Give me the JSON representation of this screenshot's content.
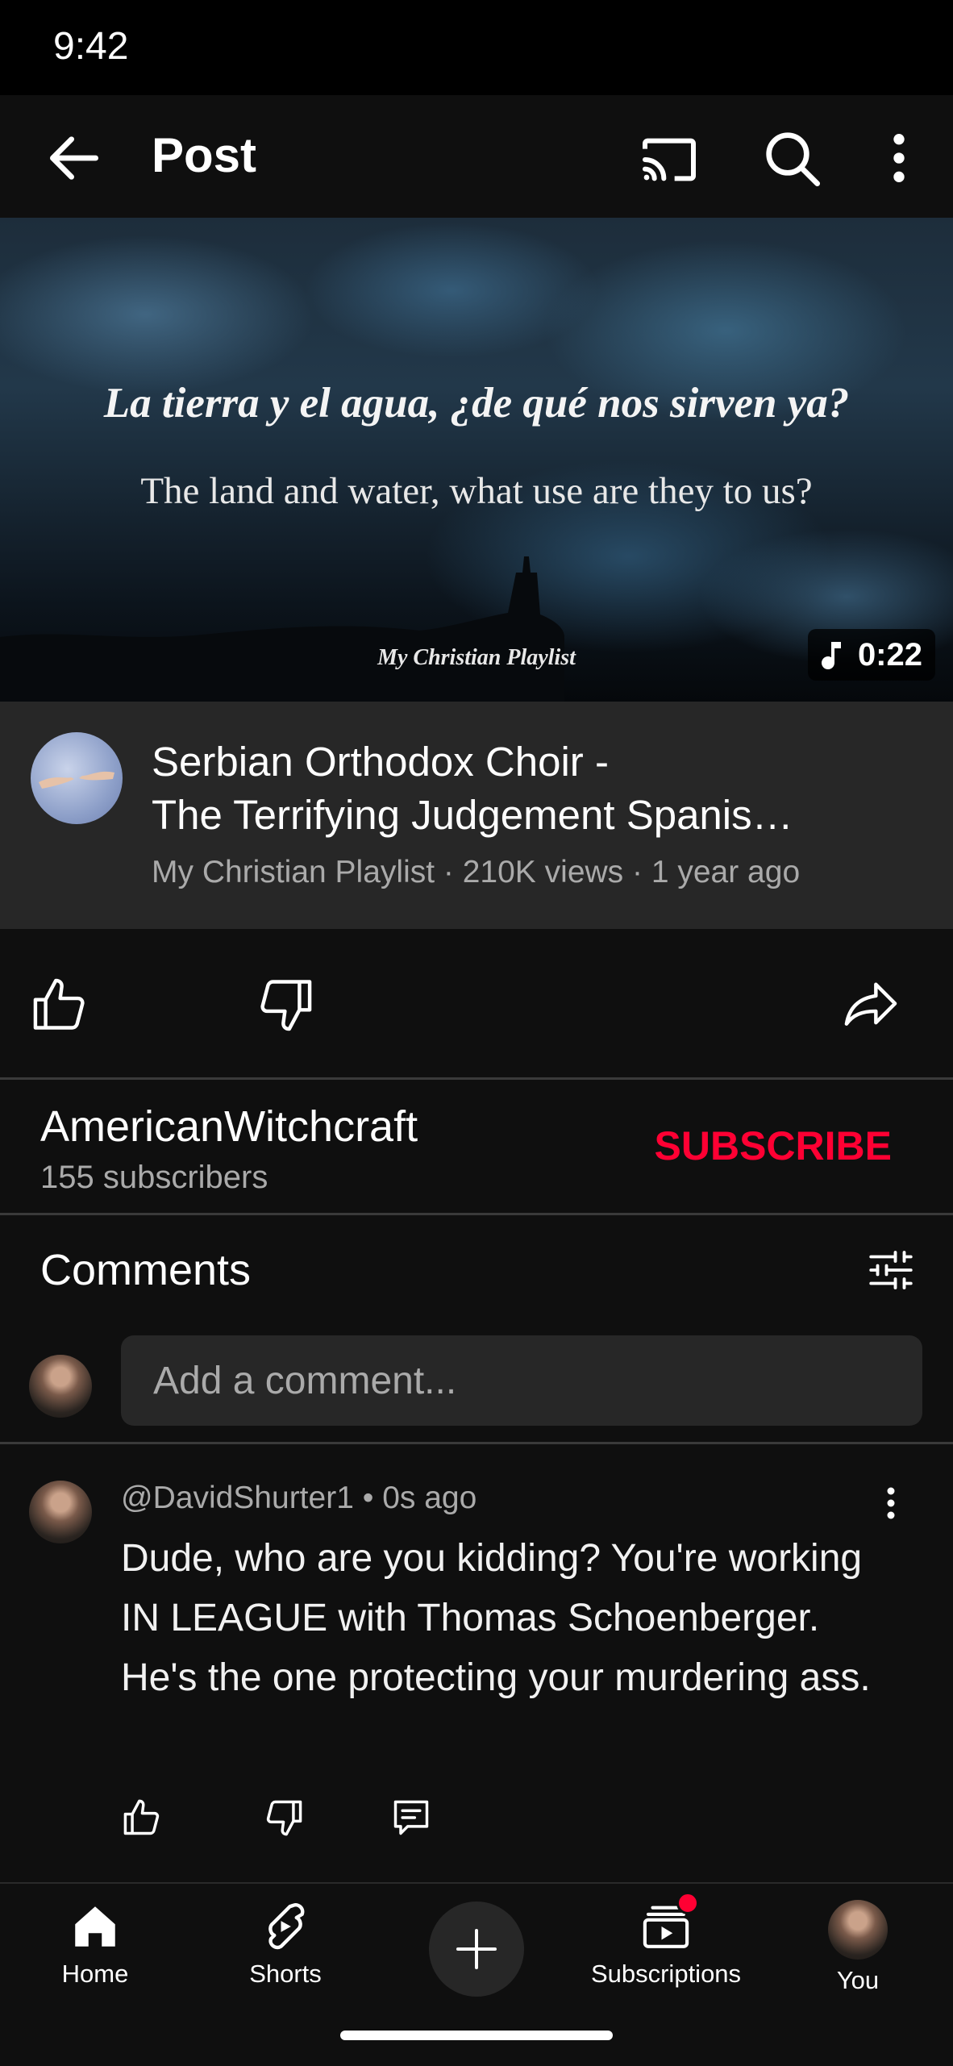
{
  "status_bar": {
    "time": "9:42"
  },
  "app_bar": {
    "title": "Post",
    "icons": [
      "back-arrow-icon",
      "cast-icon",
      "search-icon",
      "more-vert-icon"
    ]
  },
  "video": {
    "overlay_spanish": "La tierra y el agua, ¿de qué nos sirven ya?",
    "overlay_english": "The land and water, what use are they to us?",
    "overlay_credit": "My Christian Playlist",
    "duration": "0:22",
    "title_line1": "Serbian Orthodox Choir -",
    "title_line2": "The Terrifying Judgement Spanis…",
    "meta": "My Christian Playlist  · 210K views · 1 year ago"
  },
  "actions": {
    "icons": [
      "thumb-up-icon",
      "thumb-down-icon",
      "share-icon"
    ]
  },
  "channel": {
    "name": "AmericanWitchcraft",
    "subscribers": "155 subscribers",
    "subscribe_label": "SUBSCRIBE",
    "subscribe_color": "#ff0033"
  },
  "comments": {
    "heading": "Comments",
    "add_placeholder": "Add a comment...",
    "items": [
      {
        "author": "@DavidShurter1",
        "time": "0s ago",
        "header": "@DavidShurter1 • 0s ago",
        "text": "Dude, who are you kidding? You're working IN LEAGUE with Thomas Schoenberger. He's the one protecting your murdering ass."
      }
    ]
  },
  "bottom_nav": {
    "home": "Home",
    "shorts": "Shorts",
    "subscriptions": "Subscriptions",
    "you": "You"
  }
}
